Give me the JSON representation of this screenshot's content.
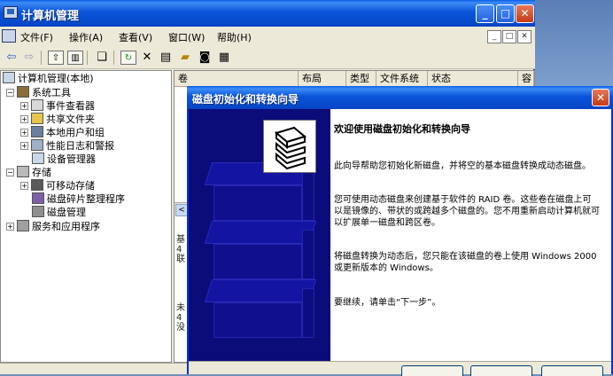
{
  "window": {
    "title": "计算机管理",
    "controls": [
      "_",
      "□",
      "✕"
    ]
  },
  "menubar": {
    "items": [
      "文件(F)",
      "操作(A)",
      "查看(V)",
      "窗口(W)",
      "帮助(H)"
    ],
    "mdi_controls": [
      "_",
      "□",
      "✕"
    ]
  },
  "toolbar": {
    "icons": [
      "back-icon",
      "forward-icon",
      "up-folder-icon",
      "show-tree-icon",
      "properties-icon",
      "refresh-icon",
      "delete-icon",
      "open-icon",
      "folder-icon",
      "search-icon",
      "export-icon"
    ]
  },
  "tree": {
    "root": "计算机管理(本地)",
    "nodes": [
      {
        "label": "系统工具",
        "level": 1,
        "expander": "−"
      },
      {
        "label": "事件查看器",
        "level": 2,
        "expander": "+"
      },
      {
        "label": "共享文件夹",
        "level": 2,
        "expander": "+"
      },
      {
        "label": "本地用户和组",
        "level": 2,
        "expander": "+"
      },
      {
        "label": "性能日志和警报",
        "level": 2,
        "expander": "+"
      },
      {
        "label": "设备管理器",
        "level": 2,
        "expander": ""
      },
      {
        "label": "存储",
        "level": 1,
        "expander": "−"
      },
      {
        "label": "可移动存储",
        "level": 2,
        "expander": "+"
      },
      {
        "label": "磁盘碎片整理程序",
        "level": 2,
        "expander": ""
      },
      {
        "label": "磁盘管理",
        "level": 2,
        "expander": ""
      },
      {
        "label": "服务和应用程序",
        "level": 1,
        "expander": "+"
      }
    ]
  },
  "list": {
    "columns": [
      "卷",
      "布局",
      "类型",
      "文件系统",
      "状态",
      "容"
    ],
    "scroll_left": "<",
    "disk_rows": [
      {
        "lines": [
          "基",
          "4",
          "联"
        ]
      },
      {
        "lines": [
          "未",
          "4",
          "没"
        ]
      }
    ]
  },
  "dialog": {
    "title": "磁盘初始化和转换向导",
    "close": "✕",
    "heading": "欢迎使用磁盘初始化和转换向导",
    "paragraphs": [
      "此向导帮助您初始化新磁盘，并将空的基本磁盘转换成动态磁盘。",
      "您可使用动态磁盘来创建基于软件的 RAID 卷。这些卷在磁盘上可以是镜像的、带状的或跨越多个磁盘的。您不用重新启动计算机就可以扩展单一磁盘和跨区卷。",
      "将磁盘转换为动态后，您只能在该磁盘的卷上使用 Windows 2000 或更新版本的 Windows。",
      "要继续，请单击“下一步”。"
    ]
  },
  "colors": {
    "title_blue": "#0a54da",
    "banner_navy": "#0b0b7a",
    "face": "#ece9d8"
  }
}
